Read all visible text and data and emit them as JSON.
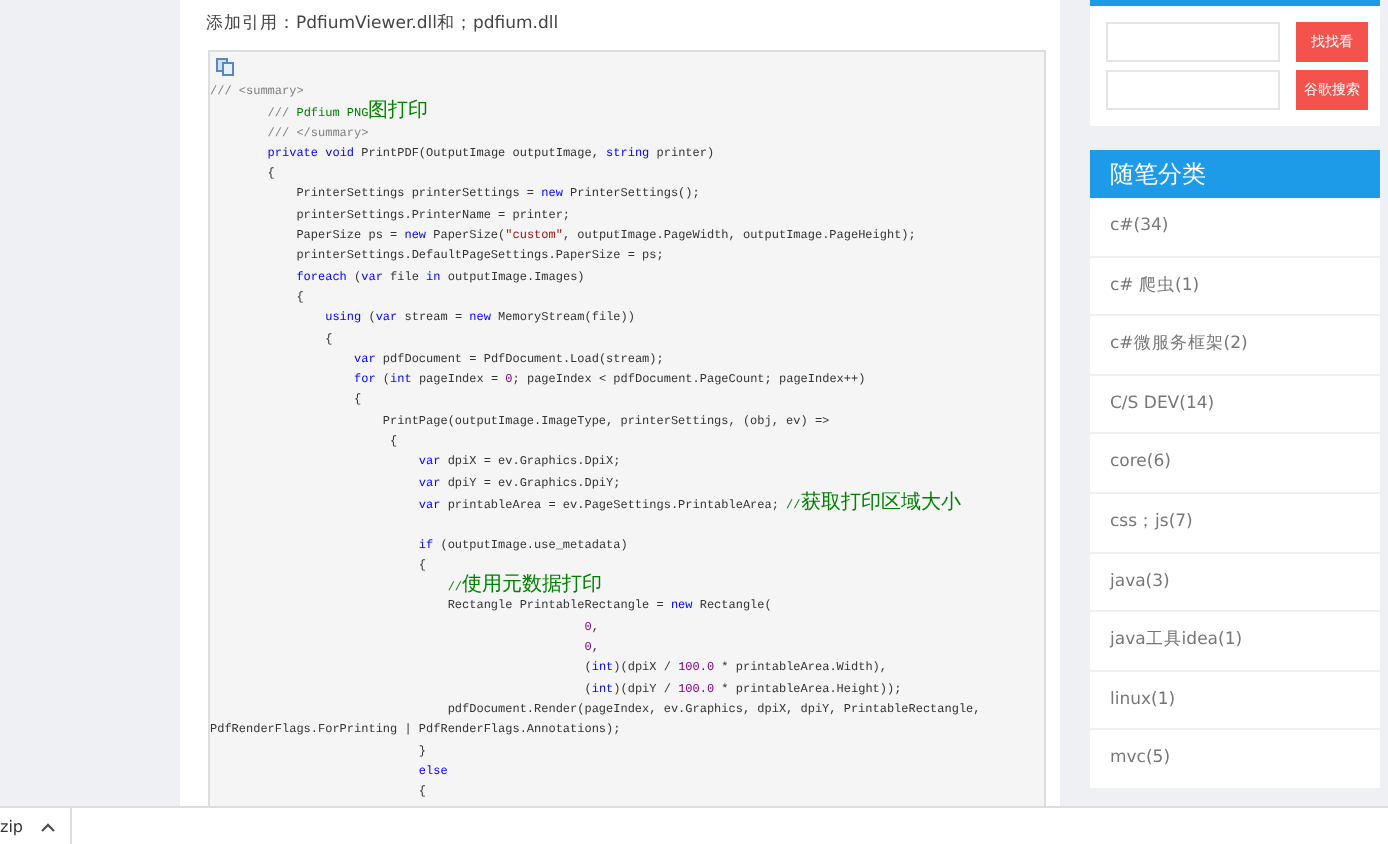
{
  "article": {
    "reference_note": "添加引用：PdfiumViewer.dll和；pdfium.dll",
    "code_lines": [
      {
        "tokens": [
          {
            "kind": "doc",
            "text": "/// <summary>"
          }
        ]
      },
      {
        "tokens": [
          {
            "kind": "doc",
            "text": "        /// "
          },
          {
            "kind": "comment",
            "text": "Pdfium PNG图打印"
          }
        ]
      },
      {
        "tokens": [
          {
            "kind": "doc",
            "text": "        /// </summary>"
          }
        ]
      },
      {
        "tokens": [
          {
            "kind": "keyword",
            "text": "        private"
          },
          {
            "kind": "keyword",
            "text": " void"
          },
          {
            "kind": "plain",
            "text": " PrintPDF(OutputImage outputImage,"
          },
          {
            "kind": "keyword",
            "text": " string"
          },
          {
            "kind": "plain",
            "text": " printer)"
          }
        ]
      },
      {
        "tokens": [
          {
            "kind": "plain",
            "text": "        {"
          }
        ]
      },
      {
        "tokens": [
          {
            "kind": "plain",
            "text": "            PrinterSettings printerSettings ="
          },
          {
            "kind": "keyword",
            "text": " new"
          },
          {
            "kind": "plain",
            "text": " PrinterSettings();"
          }
        ]
      },
      {
        "tokens": [
          {
            "kind": "plain",
            "text": "            printerSettings.PrinterName = printer;"
          }
        ]
      },
      {
        "tokens": [
          {
            "kind": "plain",
            "text": "            PaperSize ps ="
          },
          {
            "kind": "keyword",
            "text": " new"
          },
          {
            "kind": "plain",
            "text": " PaperSize("
          },
          {
            "kind": "string",
            "text": "\"custom\""
          },
          {
            "kind": "plain",
            "text": ", outputImage.PageWidth, outputImage.PageHeight);"
          }
        ]
      },
      {
        "tokens": [
          {
            "kind": "plain",
            "text": "            printerSettings.DefaultPageSettings.PaperSize = ps;"
          }
        ]
      },
      {
        "tokens": [
          {
            "kind": "keyword",
            "text": "            foreach"
          },
          {
            "kind": "plain",
            "text": " ("
          },
          {
            "kind": "keyword",
            "text": "var"
          },
          {
            "kind": "plain",
            "text": " file"
          },
          {
            "kind": "keyword",
            "text": " in"
          },
          {
            "kind": "plain",
            "text": " outputImage.Images)"
          }
        ]
      },
      {
        "tokens": [
          {
            "kind": "plain",
            "text": "            {"
          }
        ]
      },
      {
        "tokens": [
          {
            "kind": "keyword",
            "text": "                using"
          },
          {
            "kind": "plain",
            "text": " ("
          },
          {
            "kind": "keyword",
            "text": "var"
          },
          {
            "kind": "plain",
            "text": " stream ="
          },
          {
            "kind": "keyword",
            "text": " new"
          },
          {
            "kind": "plain",
            "text": " MemoryStream(file))"
          }
        ]
      },
      {
        "tokens": [
          {
            "kind": "plain",
            "text": "                {"
          }
        ]
      },
      {
        "tokens": [
          {
            "kind": "keyword",
            "text": "                    var"
          },
          {
            "kind": "plain",
            "text": " pdfDocument = PdfDocument.Load(stream);"
          }
        ]
      },
      {
        "tokens": [
          {
            "kind": "keyword",
            "text": "                    for"
          },
          {
            "kind": "plain",
            "text": " ("
          },
          {
            "kind": "keyword",
            "text": "int"
          },
          {
            "kind": "plain",
            "text": " pageIndex = "
          },
          {
            "kind": "number",
            "text": "0"
          },
          {
            "kind": "plain",
            "text": "; pageIndex < pdfDocument.PageCount; pageIndex++)"
          }
        ]
      },
      {
        "tokens": [
          {
            "kind": "plain",
            "text": "                    {"
          }
        ]
      },
      {
        "tokens": [
          {
            "kind": "plain",
            "text": "                        PrintPage(outputImage.ImageType, printerSettings, (obj, ev) =>"
          }
        ]
      },
      {
        "tokens": [
          {
            "kind": "plain",
            "text": "                         {"
          }
        ]
      },
      {
        "tokens": [
          {
            "kind": "keyword",
            "text": "                             var"
          },
          {
            "kind": "plain",
            "text": " dpiX = ev.Graphics.DpiX;"
          }
        ]
      },
      {
        "tokens": [
          {
            "kind": "keyword",
            "text": "                             var"
          },
          {
            "kind": "plain",
            "text": " dpiY = ev.Graphics.DpiY;"
          }
        ]
      },
      {
        "tokens": [
          {
            "kind": "keyword",
            "text": "                             var"
          },
          {
            "kind": "plain",
            "text": " printableArea = ev.PageSettings.PrintableArea;"
          },
          {
            "kind": "comment",
            "text": " //获取打印区域大小"
          }
        ]
      },
      {
        "kind": "blank"
      },
      {
        "tokens": [
          {
            "kind": "keyword",
            "text": "                             if"
          },
          {
            "kind": "plain",
            "text": " (outputImage.use_metadata)"
          }
        ]
      },
      {
        "tokens": [
          {
            "kind": "plain",
            "text": "                             {"
          }
        ]
      },
      {
        "tokens": [
          {
            "kind": "comment",
            "text": "                                 //使用元数据打印"
          }
        ]
      },
      {
        "tokens": [
          {
            "kind": "plain",
            "text": "                                 Rectangle PrintableRectangle ="
          },
          {
            "kind": "keyword",
            "text": " new"
          },
          {
            "kind": "plain",
            "text": " Rectangle("
          }
        ]
      },
      {
        "tokens": [
          {
            "kind": "number",
            "text": "                                                    0"
          },
          {
            "kind": "plain",
            "text": ","
          }
        ]
      },
      {
        "tokens": [
          {
            "kind": "number",
            "text": "                                                    0"
          },
          {
            "kind": "plain",
            "text": ","
          }
        ]
      },
      {
        "tokens": [
          {
            "kind": "plain",
            "text": "                                                    ("
          },
          {
            "kind": "keyword",
            "text": "int"
          },
          {
            "kind": "plain",
            "text": ")(dpiX / "
          },
          {
            "kind": "number",
            "text": "100.0"
          },
          {
            "kind": "plain",
            "text": " * printableArea.Width),"
          }
        ]
      },
      {
        "tokens": [
          {
            "kind": "plain",
            "text": "                                                    ("
          },
          {
            "kind": "keyword",
            "text": "int"
          },
          {
            "kind": "plain",
            "text": ")(dpiY / "
          },
          {
            "kind": "number",
            "text": "100.0"
          },
          {
            "kind": "plain",
            "text": " * printableArea.Height));"
          }
        ]
      },
      {
        "tokens": [
          {
            "kind": "plain",
            "text": "                                 pdfDocument.Render(pageIndex, ev.Graphics, dpiX, dpiY, PrintableRectangle,"
          }
        ]
      },
      {
        "tokens": [
          {
            "kind": "plain",
            "text": "PdfRenderFlags.ForPrinting | PdfRenderFlags.Annotations);"
          }
        ]
      },
      {
        "tokens": [
          {
            "kind": "plain",
            "text": "                             }"
          }
        ]
      },
      {
        "tokens": [
          {
            "kind": "keyword",
            "text": "                             else"
          }
        ]
      },
      {
        "tokens": [
          {
            "kind": "plain",
            "text": "                             {"
          }
        ]
      }
    ]
  },
  "sidebar": {
    "search_buttons": [
      "找找看",
      "谷歌搜索"
    ],
    "category_title": "随笔分类",
    "categories": [
      "c#(34)",
      "c# 爬虫(1)",
      "c#微服务框架(2)",
      "C/S DEV(14)",
      "core(6)",
      "css；js(7)",
      "java(3)",
      "java工具idea(1)",
      "linux(1)",
      "mvc(5)"
    ]
  },
  "download_bar": {
    "file": "zip"
  }
}
